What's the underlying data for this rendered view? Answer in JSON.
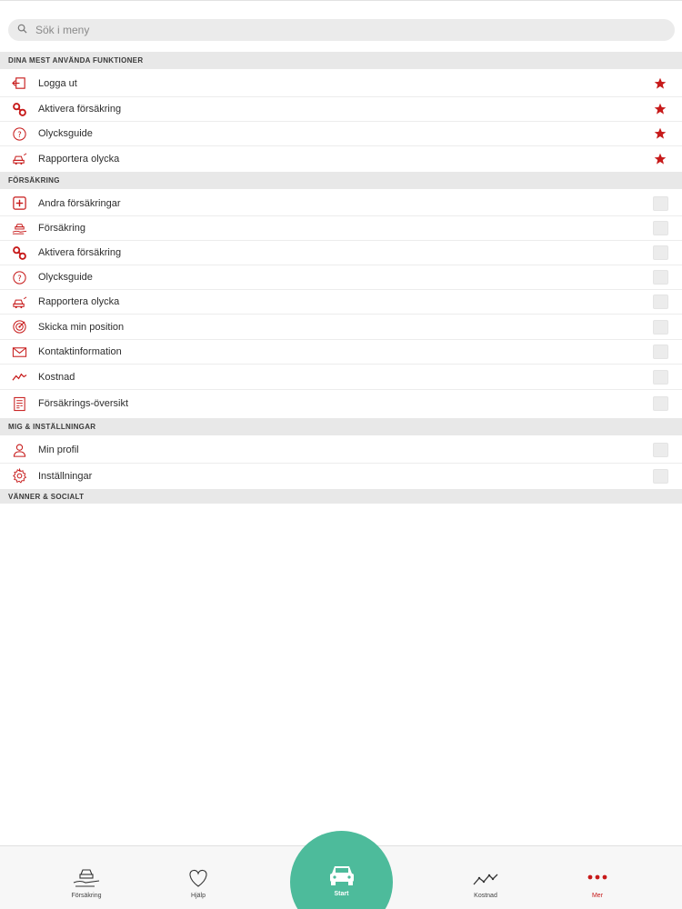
{
  "search": {
    "placeholder": "Sök i meny",
    "icon": "search-icon"
  },
  "sections": {
    "favorites": "DINA MEST ANVÄNDA FUNKTIONER",
    "insurance": "FÖRSÄKRING",
    "me_settings": "MIG & INSTÄLLNINGAR",
    "friends": "VÄNNER & SOCIALT"
  },
  "favorites": [
    {
      "label": "Logga ut",
      "icon": "logout-icon"
    },
    {
      "label": "Aktivera försäkring",
      "icon": "link-icon"
    },
    {
      "label": "Olycksguide",
      "icon": "question-icon"
    },
    {
      "label": "Rapportera olycka",
      "icon": "car-crash-icon"
    }
  ],
  "insurance": [
    {
      "label": "Andra försäkringar",
      "icon": "plus-box-icon"
    },
    {
      "label": "Försäkring",
      "icon": "car-hand-icon"
    },
    {
      "label": "Aktivera försäkring",
      "icon": "link-icon"
    },
    {
      "label": "Olycksguide",
      "icon": "question-icon"
    },
    {
      "label": "Rapportera olycka",
      "icon": "car-crash-icon"
    },
    {
      "label": "Skicka min position",
      "icon": "target-icon"
    },
    {
      "label": "Kontaktinformation",
      "icon": "envelope-icon"
    },
    {
      "label": "Kostnad",
      "icon": "line-chart-icon"
    },
    {
      "label": "Försäkrings-översikt",
      "icon": "document-icon"
    }
  ],
  "me_settings": [
    {
      "label": "Min profil",
      "icon": "person-icon"
    },
    {
      "label": "Inställningar",
      "icon": "gear-icon"
    }
  ],
  "tabbar": {
    "insurance": "Försäkring",
    "help": "Hjälp",
    "start": "Start",
    "cost": "Kostnad",
    "more": "Mer"
  },
  "colors": {
    "accent": "#c71a1a",
    "start_button": "#4dbb9b",
    "section_bg": "#e8e8e8"
  }
}
